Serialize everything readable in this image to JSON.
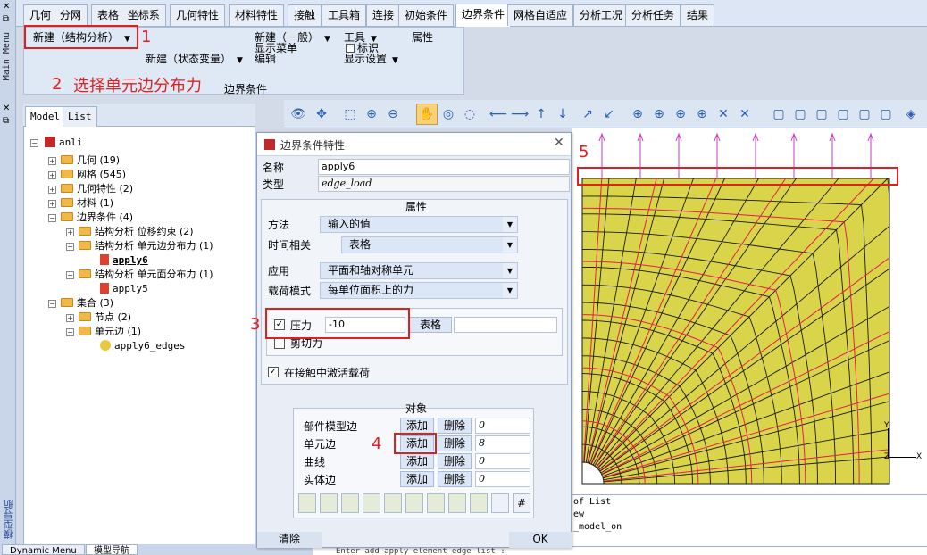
{
  "menu_tabs": [
    "几何 _分网",
    "表格 _坐标系",
    "几何特性",
    "材料特性",
    "接触",
    "工具箱",
    "连接",
    "初始条件",
    "边界条件",
    "网格自适应",
    "分析工况",
    "分析任务",
    "结果"
  ],
  "main_menu_label": "Main Menu",
  "ribbon": {
    "new_structural": "新建（结构分析）",
    "new_state_var": "新建（状态变量）",
    "new_general": "新建（一般）",
    "show_menu": "显示菜单",
    "edit": "编辑",
    "tools": "工具",
    "mark": "标识",
    "display_settings": "显示设置",
    "properties": "属性",
    "group_label": "边界条件"
  },
  "annotations": {
    "n1": "1",
    "n2": "2",
    "n2_text": "选择单元边分布力",
    "n3": "3",
    "n4": "4",
    "n5": "5"
  },
  "panel_tabs": [
    "Model",
    "List"
  ],
  "tree": {
    "root": "anli",
    "geometry": "几何 (19)",
    "mesh": "网格 (545)",
    "geom_props": "几何特性 (2)",
    "materials": "材料 (1)",
    "bc": "边界条件 (4)",
    "bc_disp": "结构分析 位移约束 (2)",
    "bc_edge": "结构分析 单元边分布力 (1)",
    "apply6_a": "apply6",
    "bc_face": "结构分析 单元面分布力 (1)",
    "apply5": "apply5",
    "sets": "集合 (3)",
    "nodes": "节点 (2)",
    "edges": "单元边 (1)",
    "apply6_edges": "apply6_edges"
  },
  "left_strip_label": "模型导航",
  "bottom_tabs": [
    "Dynamic Menu",
    "模型导航"
  ],
  "dialog": {
    "title": "边界条件特性",
    "name_label": "名称",
    "name_value": "apply6",
    "type_label": "类型",
    "type_value": "edge_load",
    "props_header": "属性",
    "method_label": "方法",
    "method_value": "输入的值",
    "time_label": "时间相关",
    "time_value": "表格",
    "apply_label": "应用",
    "apply_value": "平面和轴对称单元",
    "load_mode_label": "载荷模式",
    "load_mode_value": "每单位面积上的力",
    "pressure_label": "压力",
    "pressure_value": "-10",
    "table_btn": "表格",
    "shear_label": "剪切力",
    "contact_label": "在接触中激活载荷",
    "objects_header": "对象",
    "obj_rows": [
      {
        "label": "部件模型边",
        "add": "添加",
        "del": "删除",
        "count": "0"
      },
      {
        "label": "单元边",
        "add": "添加",
        "del": "删除",
        "count": "8"
      },
      {
        "label": "曲线",
        "add": "添加",
        "del": "删除",
        "count": "0"
      },
      {
        "label": "实体边",
        "add": "添加",
        "del": "删除",
        "count": "0"
      }
    ],
    "clear_btn": "清除",
    "ok_btn": "OK"
  },
  "console_lines": [
    "of List",
    "ew",
    "_model_on"
  ],
  "cmdline": "Enter add apply element edge list :",
  "axis": {
    "y": "Y",
    "x": "X",
    "z": "Z"
  },
  "colors": {
    "mesh_fill": "#d9d44a",
    "mesh_line": "#1a1a1a",
    "curve_line": "#e0204a",
    "arrow": "#c040c0",
    "annotation": "#e02020"
  }
}
